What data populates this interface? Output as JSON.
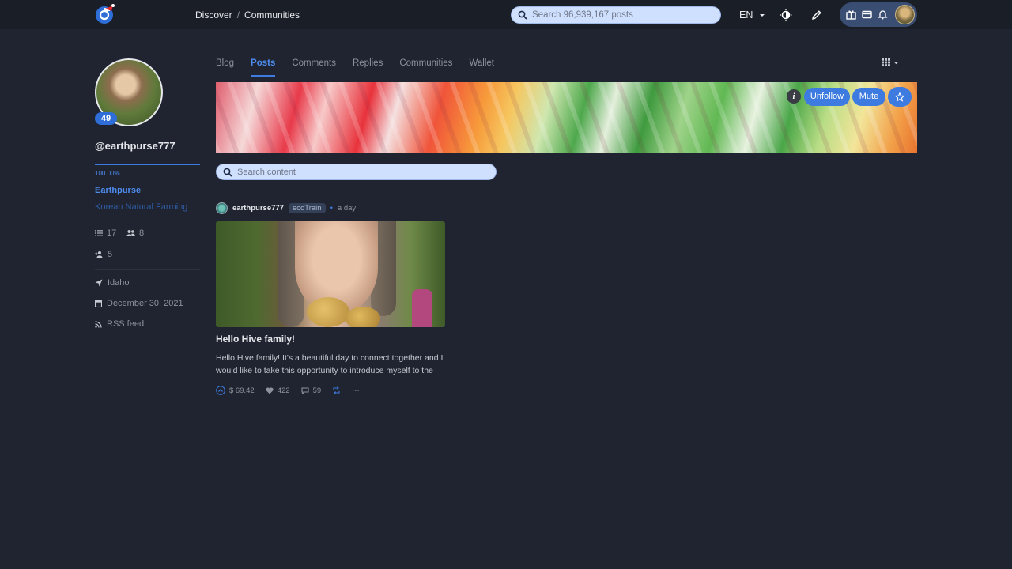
{
  "nav": {
    "breadcrumbs": [
      "Discover",
      "Communities"
    ],
    "search_placeholder": "Search 96,939,167 posts",
    "language": "EN"
  },
  "profile": {
    "reputation": "49",
    "username": "@earthpurse777",
    "voting_power": "100.00%",
    "display_name": "Earthpurse",
    "about": "Korean Natural Farming",
    "posts_count": "17",
    "followers": "8",
    "following": "5",
    "location": "Idaho",
    "joined": "December 30, 2021",
    "rss": "RSS feed"
  },
  "tabs": [
    {
      "label": "Blog",
      "active": false
    },
    {
      "label": "Posts",
      "active": true
    },
    {
      "label": "Comments",
      "active": false
    },
    {
      "label": "Replies",
      "active": false
    },
    {
      "label": "Communities",
      "active": false
    },
    {
      "label": "Wallet",
      "active": false
    }
  ],
  "banner": {
    "info_label": "i",
    "unfollow_label": "Unfollow",
    "mute_label": "Mute"
  },
  "content_search_placeholder": "Search content",
  "post": {
    "author": "earthpurse777",
    "community": "ecoTrain",
    "time": "a day",
    "title": "Hello Hive family!",
    "body": "Hello Hive family! It's a beautiful day to connect together and I would like to take this opportunity to introduce myself to the",
    "payout": "$ 69.42",
    "votes": "422",
    "comments": "59",
    "more": "···"
  },
  "colors": {
    "background": "#1f2430",
    "topbar": "#1a1e27",
    "accent": "#3d7be0",
    "search_bg": "#cfe0ff"
  }
}
